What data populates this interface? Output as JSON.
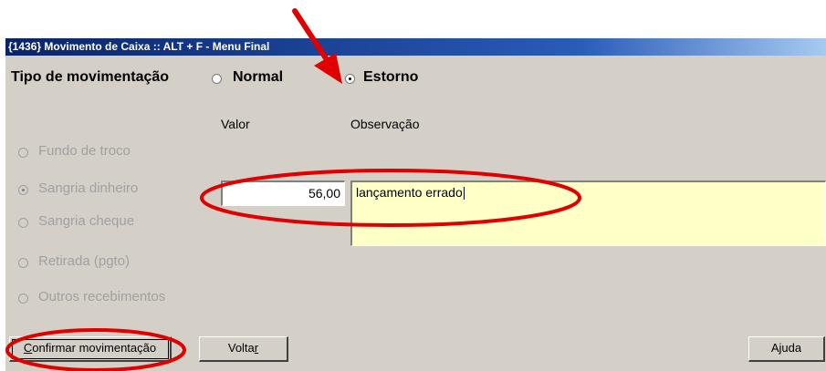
{
  "window": {
    "title": "{1436} Movimento de Caixa :: ALT + F - Menu Final"
  },
  "tipo": {
    "label": "Tipo de movimentação",
    "options": [
      {
        "label": "Normal",
        "checked": false
      },
      {
        "label": "Estorno",
        "checked": true
      }
    ]
  },
  "columns": {
    "valor": "Valor",
    "observacao": "Observação"
  },
  "movement_options": [
    {
      "label": "Fundo de troco",
      "checked": false,
      "enabled": false
    },
    {
      "label": "Sangria dinheiro",
      "checked": true,
      "enabled": false
    },
    {
      "label": "Sangria cheque",
      "checked": false,
      "enabled": false
    },
    {
      "label": "Retirada (pgto)",
      "checked": false,
      "enabled": false
    },
    {
      "label": "Outros recebimentos",
      "checked": false,
      "enabled": false
    }
  ],
  "fields": {
    "valor": "56,00",
    "observacao": "lançamento errado"
  },
  "buttons": {
    "confirmar_first": "C",
    "confirmar_rest": "onfirmar movimentação",
    "voltar_main": "Volta",
    "voltar_underlined": "r",
    "ajuda": "Ajuda"
  },
  "annotation_color": "#e00000"
}
